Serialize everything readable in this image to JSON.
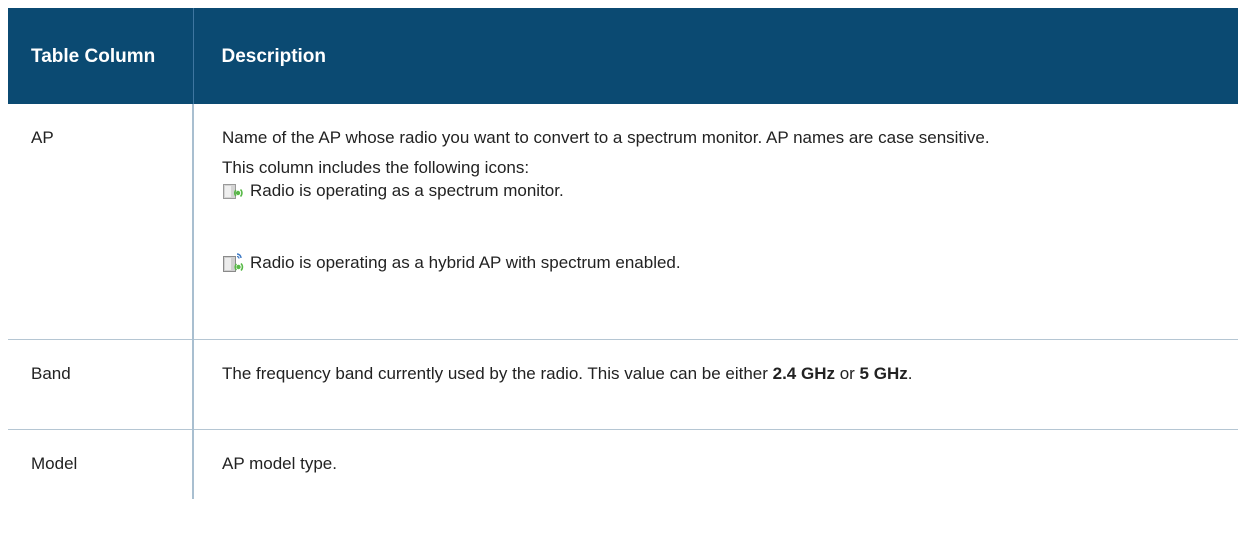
{
  "header": {
    "col1": "Table Column",
    "col2": "Description"
  },
  "rows": [
    {
      "name": "AP",
      "desc1": "Name of the AP whose radio you want to convert to a spectrum monitor. AP names are case sensitive.",
      "desc2": "This column includes the following icons:",
      "icons": [
        {
          "icon": "spectrum-monitor-icon",
          "text": "Radio is operating as a spectrum monitor."
        },
        {
          "icon": "hybrid-ap-spectrum-icon",
          "text": "Radio is operating as a hybrid AP with spectrum enabled."
        }
      ]
    },
    {
      "name": "Band",
      "desc_pre": "The frequency band currently used by the radio. This value can be either ",
      "bold1": "2.4 GHz",
      "mid": " or ",
      "bold2": "5 GHz",
      "post": "."
    },
    {
      "name": "Model",
      "desc": "AP model type."
    }
  ],
  "colors": {
    "header_bg": "#0b4a72",
    "header_text": "#ffffff",
    "rule": "#b5c6d3"
  }
}
